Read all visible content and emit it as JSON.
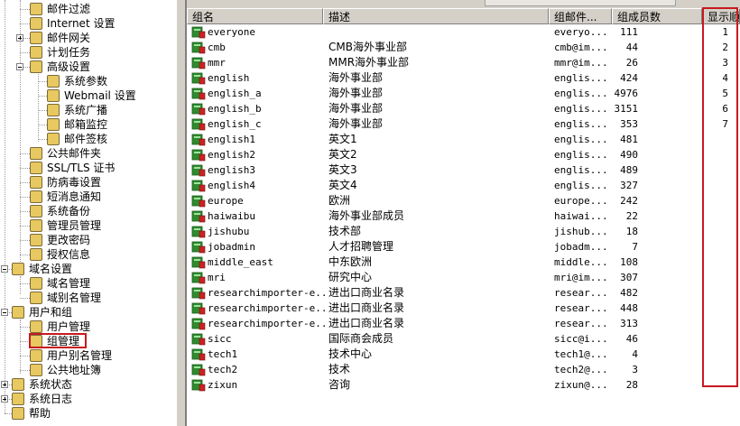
{
  "tree": {
    "items": [
      {
        "label": "邮件过滤",
        "icon": "filter-icon",
        "level": 2
      },
      {
        "label": "Internet 设置",
        "icon": "internet-icon",
        "level": 2
      },
      {
        "label": "邮件网关",
        "icon": "gateway-icon",
        "level": 2,
        "expander": "plus"
      },
      {
        "label": "计划任务",
        "icon": "scheduled-task-icon",
        "level": 2
      },
      {
        "label": "高级设置",
        "icon": "advanced-settings-icon",
        "level": 2,
        "expander": "minus"
      },
      {
        "label": "系统参数",
        "icon": "system-params-icon",
        "level": 3
      },
      {
        "label": "Webmail 设置",
        "icon": "webmail-icon",
        "level": 3
      },
      {
        "label": "系统广播",
        "icon": "broadcast-icon",
        "level": 3
      },
      {
        "label": "邮箱监控",
        "icon": "mailbox-monitor-icon",
        "level": 3
      },
      {
        "label": "邮件签核",
        "icon": "mail-approval-icon",
        "level": 3
      },
      {
        "label": "公共邮件夹",
        "icon": "public-folder-icon",
        "level": 2
      },
      {
        "label": "SSL/TLS 证书",
        "icon": "certificate-icon",
        "level": 2
      },
      {
        "label": "防病毒设置",
        "icon": "antivirus-icon",
        "level": 2
      },
      {
        "label": "短消息通知",
        "icon": "sms-icon",
        "level": 2
      },
      {
        "label": "系统备份",
        "icon": "backup-icon",
        "level": 2
      },
      {
        "label": "管理员管理",
        "icon": "admin-icon",
        "level": 2
      },
      {
        "label": "更改密码",
        "icon": "password-icon",
        "level": 2
      },
      {
        "label": "授权信息",
        "icon": "license-icon",
        "level": 2
      },
      {
        "label": "域名设置",
        "icon": "domain-settings-icon",
        "level": 1,
        "expander": "minus"
      },
      {
        "label": "域名管理",
        "icon": "domain-manage-icon",
        "level": 2
      },
      {
        "label": "域别名管理",
        "icon": "domain-alias-icon",
        "level": 2
      },
      {
        "label": "用户和组",
        "icon": "users-groups-icon",
        "level": 1,
        "expander": "minus"
      },
      {
        "label": "用户管理",
        "icon": "user-manage-icon",
        "level": 2
      },
      {
        "label": "组管理",
        "icon": "group-manage-icon",
        "level": 2,
        "selected": true
      },
      {
        "label": "用户别名管理",
        "icon": "user-alias-icon",
        "level": 2
      },
      {
        "label": "公共地址簿",
        "icon": "address-book-icon",
        "level": 2
      },
      {
        "label": "系统状态",
        "icon": "system-status-icon",
        "level": 1,
        "expander": "plus"
      },
      {
        "label": "系统日志",
        "icon": "system-log-icon",
        "level": 1,
        "expander": "plus"
      },
      {
        "label": "帮助",
        "icon": "help-icon",
        "level": 1
      }
    ]
  },
  "list": {
    "columns": [
      "组名",
      "描述",
      "组邮件...",
      "组成员数",
      "显示顺"
    ],
    "rows": [
      {
        "name": "everyone",
        "desc": "",
        "mail": "everyo...",
        "count": "111",
        "order": "1"
      },
      {
        "name": "cmb",
        "desc": "CMB海外事业部",
        "mail": "cmb@im...",
        "count": "44",
        "order": "2"
      },
      {
        "name": "mmr",
        "desc": "MMR海外事业部",
        "mail": "mmr@im...",
        "count": "26",
        "order": "3"
      },
      {
        "name": "english",
        "desc": "海外事业部",
        "mail": "englis...",
        "count": "424",
        "order": "4"
      },
      {
        "name": "english_a",
        "desc": "海外事业部",
        "mail": "englis...",
        "count": "4976",
        "order": "5"
      },
      {
        "name": "english_b",
        "desc": "海外事业部",
        "mail": "englis...",
        "count": "3151",
        "order": "6"
      },
      {
        "name": "english_c",
        "desc": "海外事业部",
        "mail": "englis...",
        "count": "353",
        "order": "7"
      },
      {
        "name": "english1",
        "desc": "英文1",
        "mail": "englis...",
        "count": "481",
        "order": ""
      },
      {
        "name": "english2",
        "desc": "英文2",
        "mail": "englis...",
        "count": "490",
        "order": ""
      },
      {
        "name": "english3",
        "desc": "英文3",
        "mail": "englis...",
        "count": "489",
        "order": ""
      },
      {
        "name": "english4",
        "desc": "英文4",
        "mail": "englis...",
        "count": "327",
        "order": ""
      },
      {
        "name": "europe",
        "desc": "欧洲",
        "mail": "europe...",
        "count": "242",
        "order": ""
      },
      {
        "name": "haiwaibu",
        "desc": "海外事业部成员",
        "mail": "haiwai...",
        "count": "22",
        "order": ""
      },
      {
        "name": "jishubu",
        "desc": "技术部",
        "mail": "jishub...",
        "count": "18",
        "order": ""
      },
      {
        "name": "jobadmin",
        "desc": "人才招聘管理",
        "mail": "jobadm...",
        "count": "7",
        "order": ""
      },
      {
        "name": "middle_east",
        "desc": "中东欧洲",
        "mail": "middle...",
        "count": "108",
        "order": ""
      },
      {
        "name": "mri",
        "desc": "研究中心",
        "mail": "mri@im...",
        "count": "307",
        "order": ""
      },
      {
        "name": "researchimporter-e...",
        "desc": "进出口商业名录",
        "mail": "resear...",
        "count": "482",
        "order": ""
      },
      {
        "name": "researchimporter-e...",
        "desc": "进出口商业名录",
        "mail": "resear...",
        "count": "448",
        "order": ""
      },
      {
        "name": "researchimporter-e...",
        "desc": "进出口商业名录",
        "mail": "resear...",
        "count": "313",
        "order": ""
      },
      {
        "name": "sicc",
        "desc": "国际商会成员",
        "mail": "sicc@i...",
        "count": "46",
        "order": ""
      },
      {
        "name": "tech1",
        "desc": "技术中心",
        "mail": "tech1@...",
        "count": "4",
        "order": ""
      },
      {
        "name": "tech2",
        "desc": "技术",
        "mail": "tech2@...",
        "count": "3",
        "order": ""
      },
      {
        "name": "zixun",
        "desc": "咨询",
        "mail": "zixun@...",
        "count": "28",
        "order": ""
      }
    ]
  },
  "colors": {
    "highlight_red": "#c8191e",
    "header_gray": "#d4d0c8",
    "group_icon_green": "#2e8b2e"
  }
}
